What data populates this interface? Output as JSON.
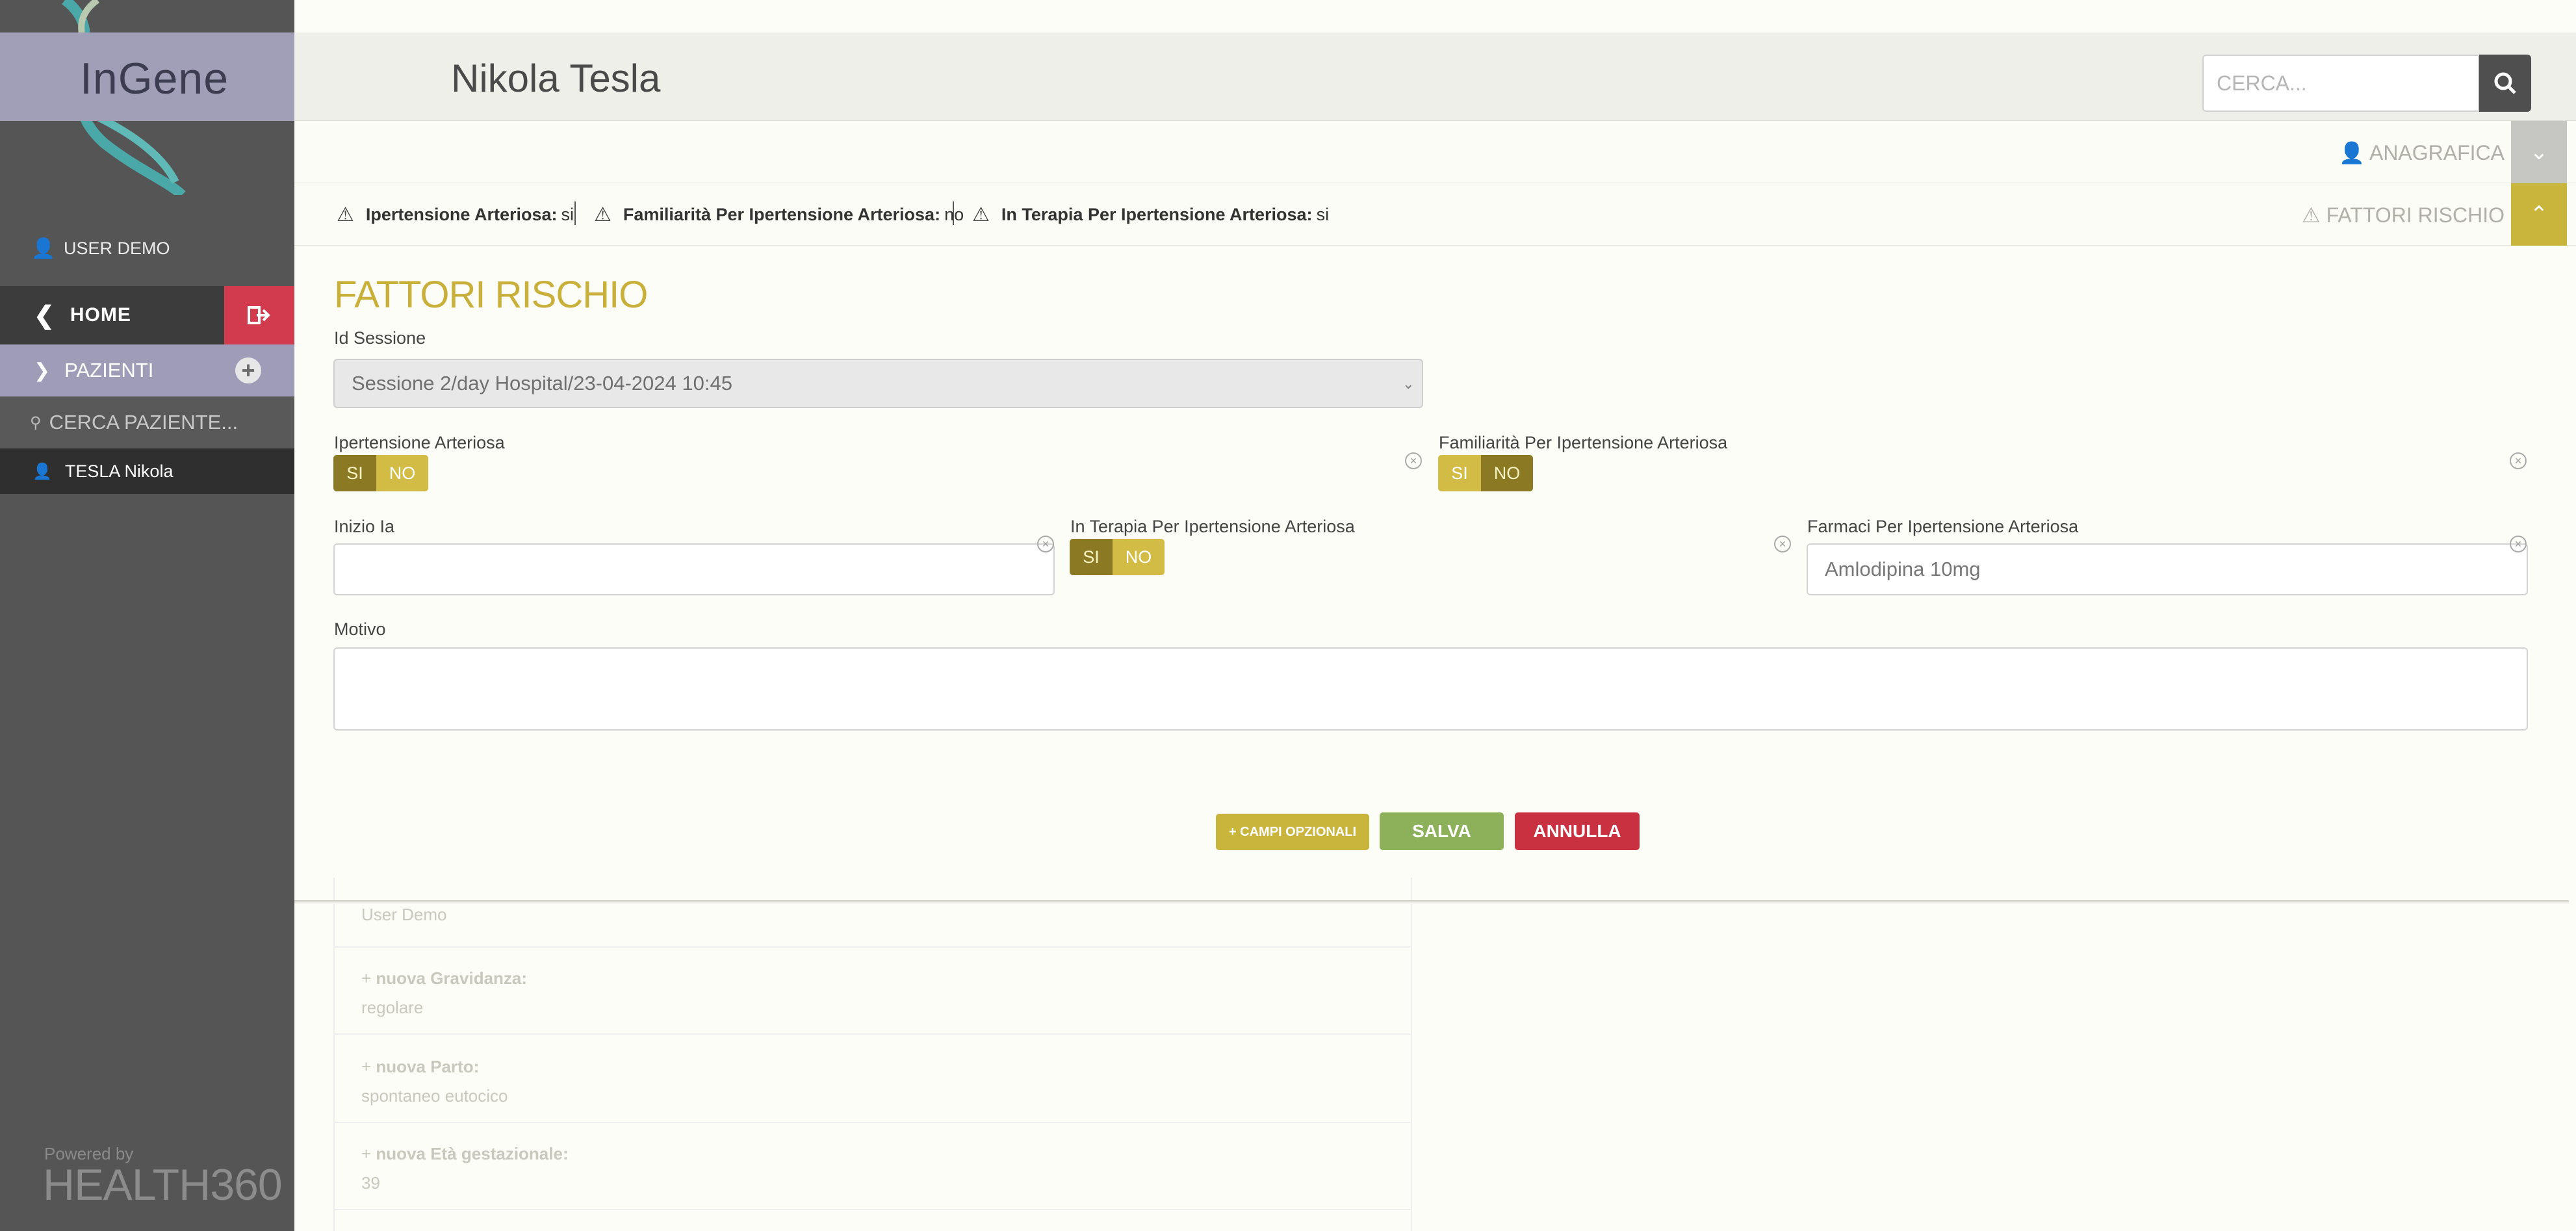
{
  "app": {
    "logo": "InGene"
  },
  "sidebar": {
    "user": "USER DEMO",
    "home": "HOME",
    "pazienti": "PAZIENTI",
    "search_placeholder": "CERCA PAZIENTE...",
    "patient": "TESLA Nikola",
    "powered_by": "Powered by",
    "brand": "HEALTH360"
  },
  "header": {
    "patient_name": "Nikola Tesla",
    "search_placeholder": "CERCA..."
  },
  "accordions": {
    "anagrafica": "ANAGRAFICA",
    "fattori_rischio": "FATTORI RISCHIO"
  },
  "alerts": [
    {
      "label": "Ipertensione Arteriosa:",
      "value": "si"
    },
    {
      "label": "Familiarità Per Ipertensione Arteriosa:",
      "value": "no"
    },
    {
      "label": "In Terapia Per Ipertensione Arteriosa:",
      "value": "si"
    }
  ],
  "form": {
    "title": "FATTORI RISCHIO",
    "id_sessione_label": "Id Sessione",
    "id_sessione_value": "Sessione 2/day Hospital/23-04-2024 10:45",
    "ipertensione_label": "Ipertensione Arteriosa",
    "familiarita_label": "Familiarità Per Ipertensione Arteriosa",
    "inizio_label": "Inizio Ia",
    "inizio_value": "",
    "terapia_label": "In Terapia Per Ipertensione Arteriosa",
    "farmaci_label": "Farmaci Per Ipertensione Arteriosa",
    "farmaci_value": "Amlodipina 10mg",
    "motivo_label": "Motivo",
    "motivo_value": "",
    "toggle_si": "SI",
    "toggle_no": "NO",
    "campi_opzionali": "+ CAMPI OPZIONALI",
    "salva": "SALVA",
    "annulla": "ANNULLA"
  },
  "background_list": [
    {
      "value": "User Demo"
    },
    {
      "title": "nuova Gravidanza:",
      "value": "regolare"
    },
    {
      "title": "nuova Parto:",
      "value": "spontaneo eutocico"
    },
    {
      "title": "nuova Età gestazionale:",
      "value": "39"
    }
  ],
  "colors": {
    "accent_yellow": "#c9b43c",
    "toggle_dark": "#8b7a23",
    "save_green": "#8db05a",
    "cancel_red": "#c93140",
    "sidebar_bg": "#555555",
    "logout_red": "#d23b4e"
  }
}
